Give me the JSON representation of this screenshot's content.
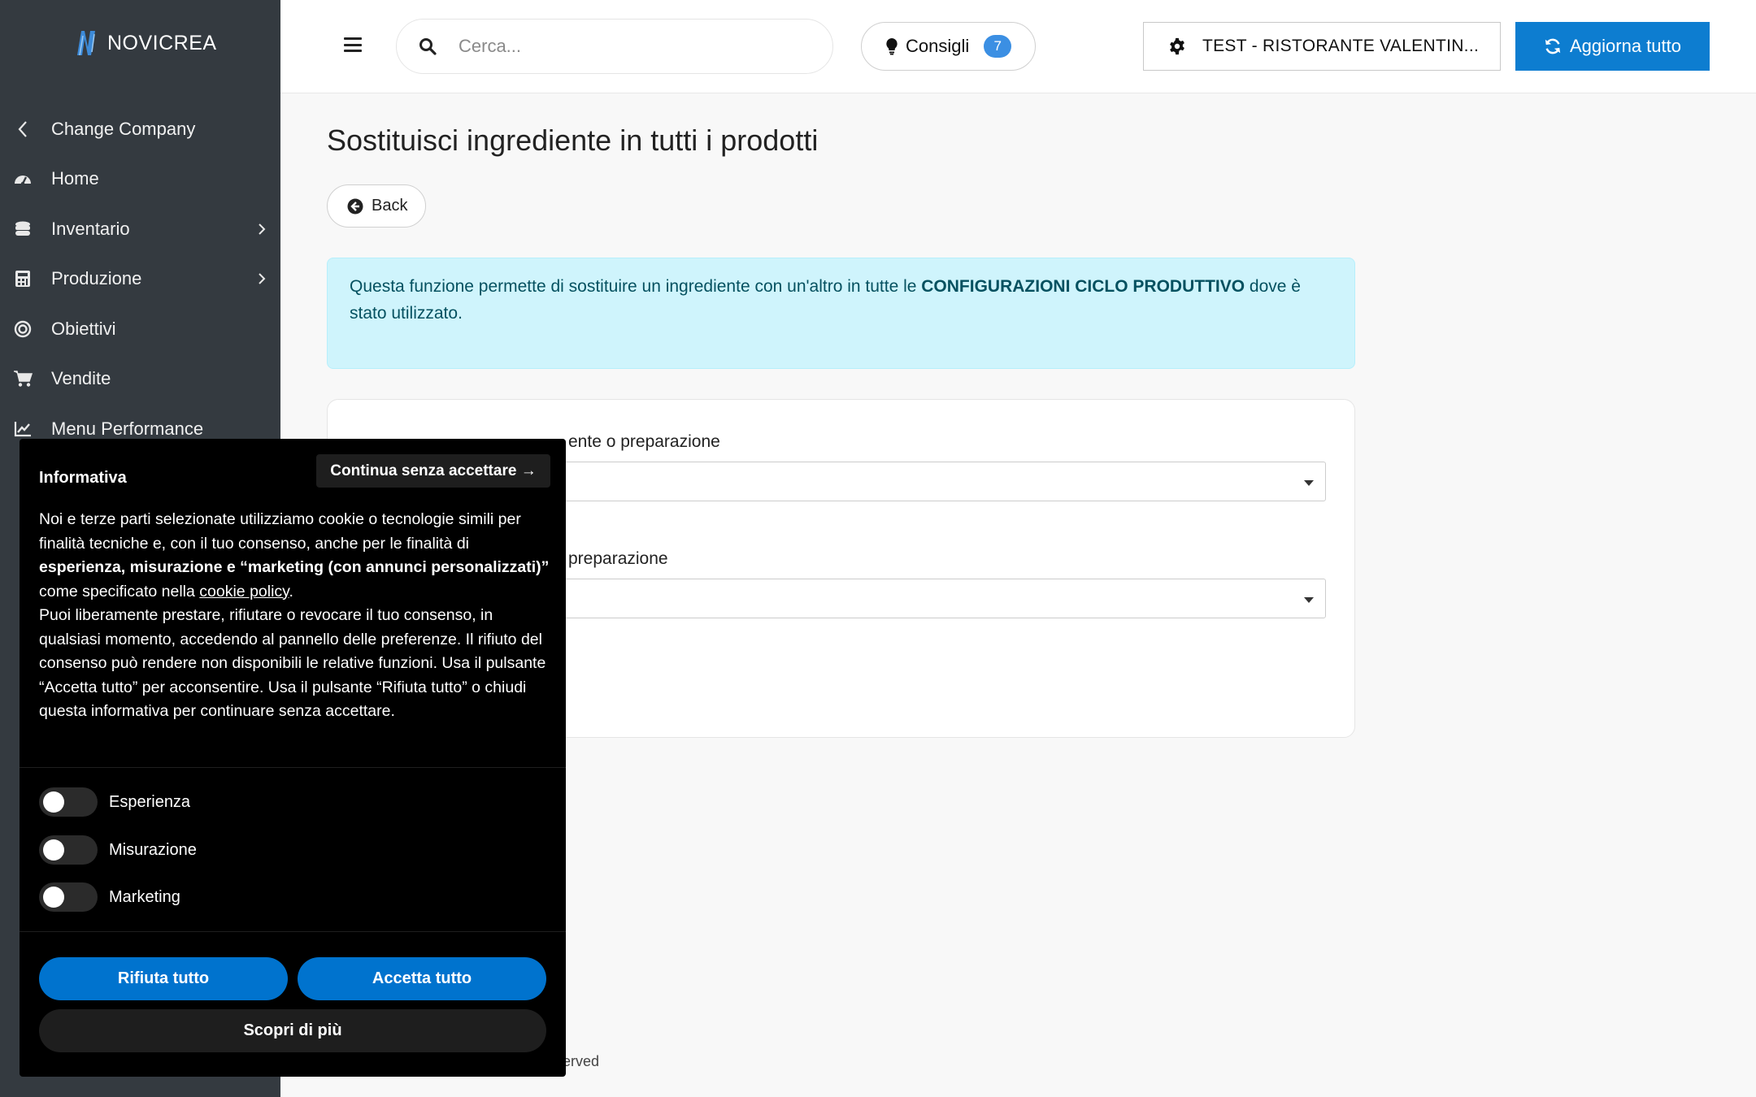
{
  "brand": {
    "name": "NOVICREA"
  },
  "sidebar": {
    "items": [
      {
        "label": "Change Company",
        "icon": "chevron-left-icon"
      },
      {
        "label": "Home",
        "icon": "dashboard-icon"
      },
      {
        "label": "Inventario",
        "icon": "database-icon",
        "has_submenu": true
      },
      {
        "label": "Produzione",
        "icon": "calculator-icon",
        "has_submenu": true
      },
      {
        "label": "Obiettivi",
        "icon": "target-icon"
      },
      {
        "label": "Vendite",
        "icon": "cart-icon"
      },
      {
        "label": "Menu Performance",
        "icon": "chart-line-icon"
      }
    ]
  },
  "topbar": {
    "search_placeholder": "Cerca...",
    "tips_label": "Consigli",
    "tips_count": "7",
    "company_label": "TEST - RISTORANTE VALENTIN...",
    "update_label": "Aggiorna tutto"
  },
  "main": {
    "title": "Sostituisci ingrediente in tutti i prodotti",
    "back_label": "Back",
    "alert": {
      "text_before": "Questa funzione permette di sostituire un ingrediente con un'altro in tutte le ",
      "text_bold": "CONFIGURAZIONI CICLO PRODUTTIVO",
      "text_after": " dove è stato utilizzato."
    },
    "form": {
      "label_1": "ente o preparazione",
      "label_2": "preparazione"
    },
    "footer_fragment": "erved"
  },
  "cookie_banner": {
    "title": "Informativa",
    "continue_label": "Continua senza accettare →",
    "body_1": "Noi e terze parti selezionate utilizziamo cookie o tecnologie simili per finalità tecniche e, con il tuo consenso, anche per le finalità di ",
    "body_bold": "esperienza, misurazione e “marketing (con annunci personalizzati)”",
    "body_2": " come specificato nella ",
    "body_link": "cookie policy",
    "body_3": ".",
    "body_4": "Puoi liberamente prestare, rifiutare o revocare il tuo consenso, in qualsiasi momento, accedendo al pannello delle preferenze. Il rifiuto del consenso può rendere non disponibili le relative funzioni. Usa il pulsante “Accetta tutto” per acconsentire. Usa il pulsante “Rifiuta tutto” o chiudi questa informativa per continuare senza accettare.",
    "toggles": [
      {
        "label": "Esperienza",
        "on": false
      },
      {
        "label": "Misurazione",
        "on": false
      },
      {
        "label": "Marketing",
        "on": false
      }
    ],
    "reject_label": "Rifiuta tutto",
    "accept_label": "Accetta tutto",
    "more_label": "Scopri di più"
  },
  "colors": {
    "sidebar_bg": "#343a40",
    "primary": "#0d7dd0",
    "alert_bg": "#cff4fc",
    "alert_text": "#055160",
    "cookie_blue": "#0073ce"
  }
}
